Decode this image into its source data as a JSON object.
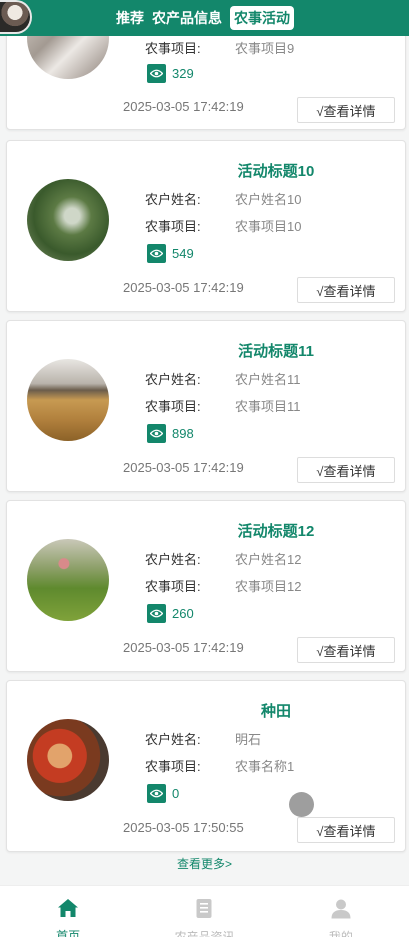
{
  "header": {
    "tabs": [
      {
        "label": "推荐"
      },
      {
        "label": "农产品信息"
      },
      {
        "label": "农事活动",
        "active": true
      }
    ]
  },
  "labels": {
    "farmer": "农户姓名:",
    "project": "农事项目:",
    "detail": "√查看详情",
    "more": "查看更多>"
  },
  "cards": [
    {
      "title": "",
      "farmer": "",
      "project": "农事项目9",
      "views": "329",
      "time": "2025-03-05 17:42:19"
    },
    {
      "title": "活动标题10",
      "farmer": "农户姓名10",
      "project": "农事项目10",
      "views": "549",
      "time": "2025-03-05 17:42:19"
    },
    {
      "title": "活动标题11",
      "farmer": "农户姓名11",
      "project": "农事项目11",
      "views": "898",
      "time": "2025-03-05 17:42:19"
    },
    {
      "title": "活动标题12",
      "farmer": "农户姓名12",
      "project": "农事项目12",
      "views": "260",
      "time": "2025-03-05 17:42:19"
    },
    {
      "title": "种田",
      "farmer": "明石",
      "project": "农事名称1",
      "views": "0",
      "time": "2025-03-05 17:50:55"
    }
  ],
  "bottom_nav": [
    {
      "label": "首页",
      "icon": "home-icon",
      "active": true
    },
    {
      "label": "农产品资讯",
      "icon": "news-icon",
      "active": false
    },
    {
      "label": "我的",
      "icon": "user-icon",
      "active": false
    }
  ],
  "colors": {
    "accent": "#13876b",
    "bg": "#f4f5f5"
  }
}
